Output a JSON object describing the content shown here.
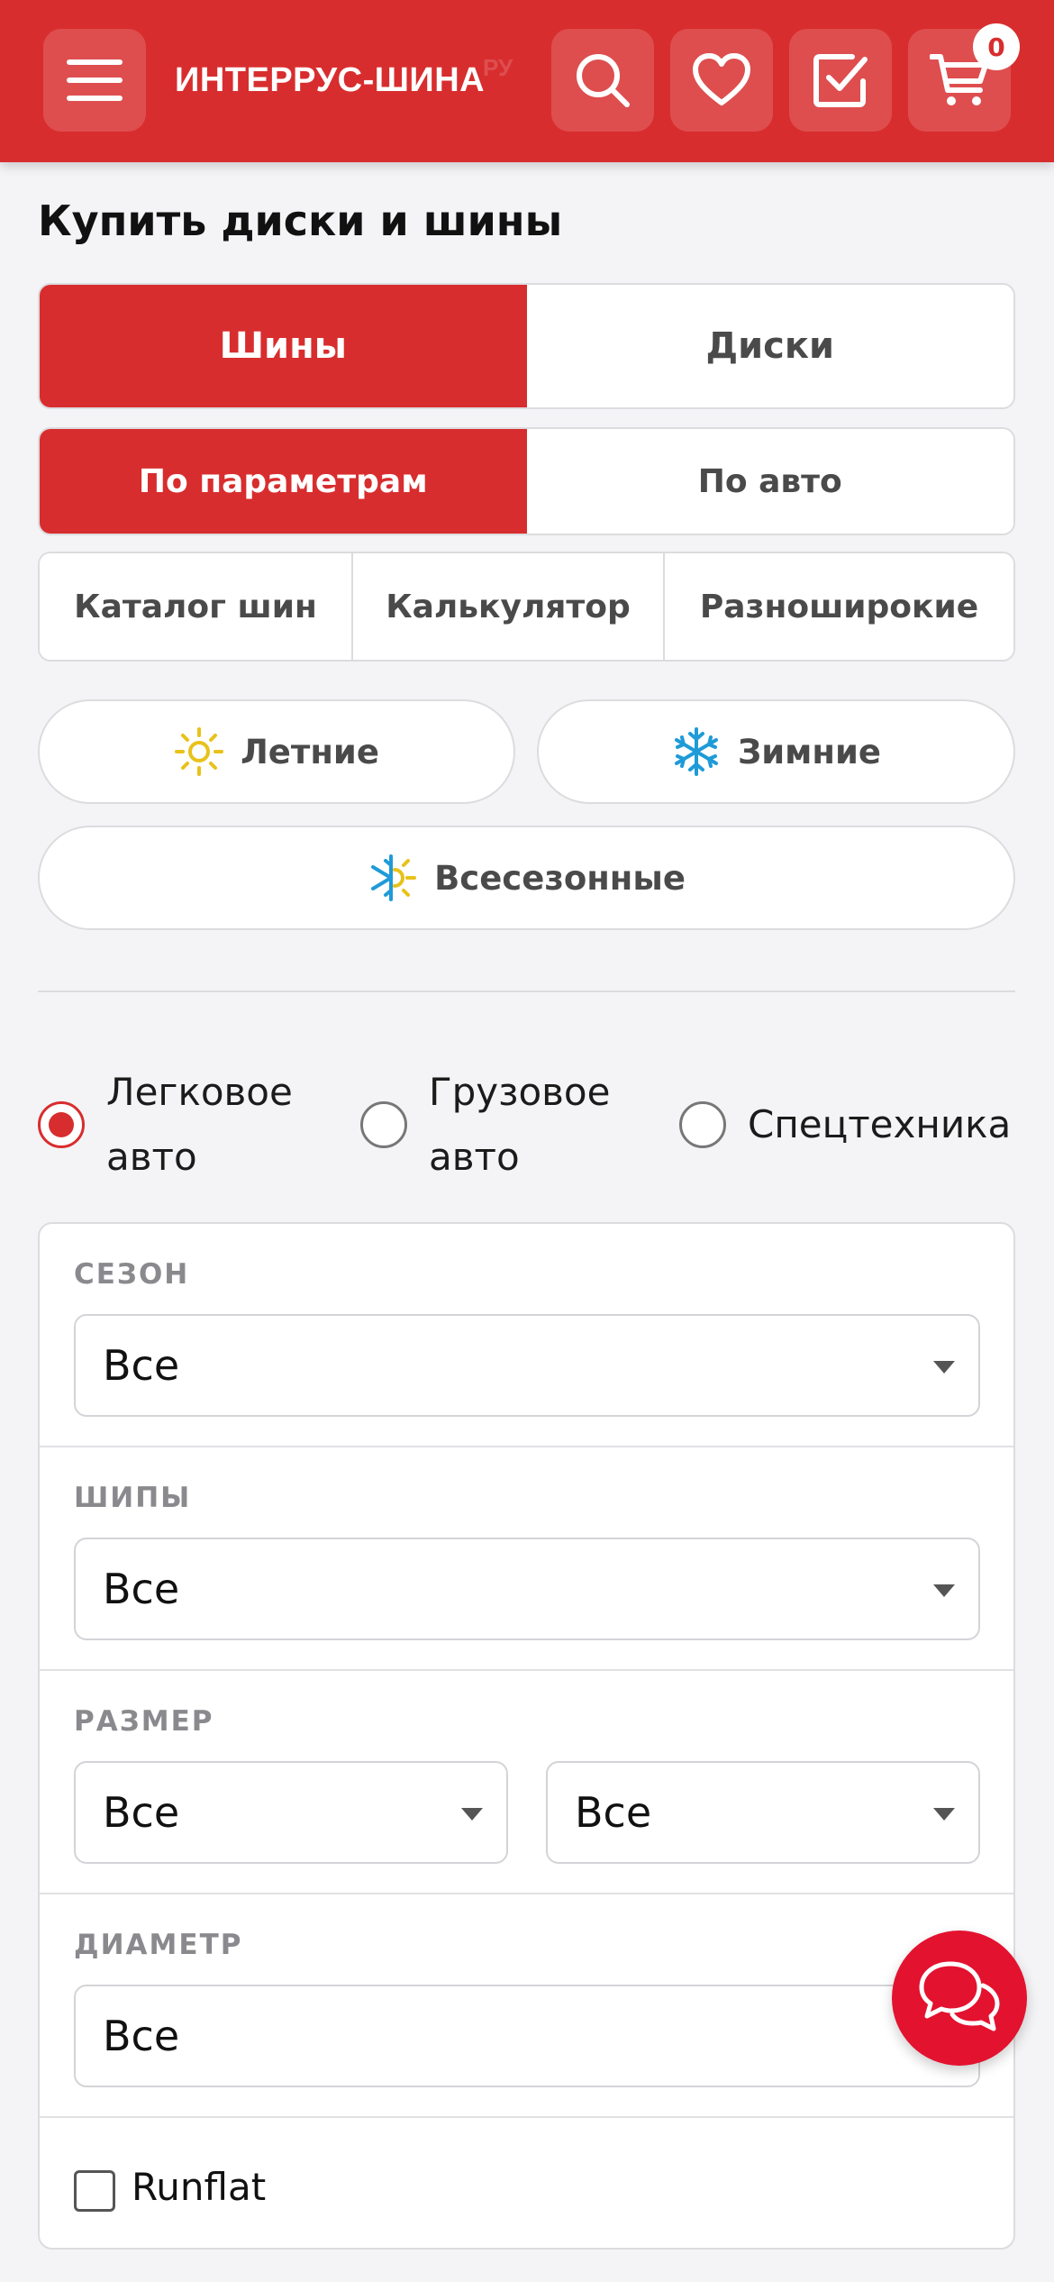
{
  "header": {
    "logo": "ИНТЕРРУС-ШИНА",
    "logo_suffix": "РУ",
    "cart_count": "0",
    "brand_color": "#d82d2e"
  },
  "page_title": "Купить диски и шины",
  "product_tabs": [
    {
      "label": "Шины",
      "active": true
    },
    {
      "label": "Диски",
      "active": false
    }
  ],
  "search_mode_tabs": [
    {
      "label": "По параметрам",
      "active": true
    },
    {
      "label": "По авто",
      "active": false
    }
  ],
  "catalog_tabs": [
    {
      "label": "Каталог шин"
    },
    {
      "label": "Калькулятор"
    },
    {
      "label": "Разноширокие"
    }
  ],
  "seasons": [
    {
      "label": "Летние",
      "icon": "sun-icon"
    },
    {
      "label": "Зимние",
      "icon": "snowflake-icon"
    },
    {
      "label": "Всесезонные",
      "icon": "all-season-icon"
    }
  ],
  "vehicle_types": [
    {
      "label_line1": "Легковое",
      "label_line2": "авто",
      "checked": true
    },
    {
      "label_line1": "Грузовое",
      "label_line2": "авто",
      "checked": false
    },
    {
      "label_line1": "Спецтехника",
      "label_line2": "",
      "checked": false
    }
  ],
  "filters": {
    "season": {
      "label": "СЕЗОН",
      "value": "Все"
    },
    "spikes": {
      "label": "ШИПЫ",
      "value": "Все"
    },
    "size": {
      "label": "РАЗМЕР",
      "width_value": "Все",
      "separator": "/",
      "profile_value": "Все"
    },
    "diameter": {
      "label": "ДИАМЕТР",
      "value": "Все"
    },
    "runflat": {
      "label": "Runflat",
      "checked": false
    }
  },
  "chat_button": {
    "icon": "chat-icon",
    "color": "#e3122f"
  }
}
